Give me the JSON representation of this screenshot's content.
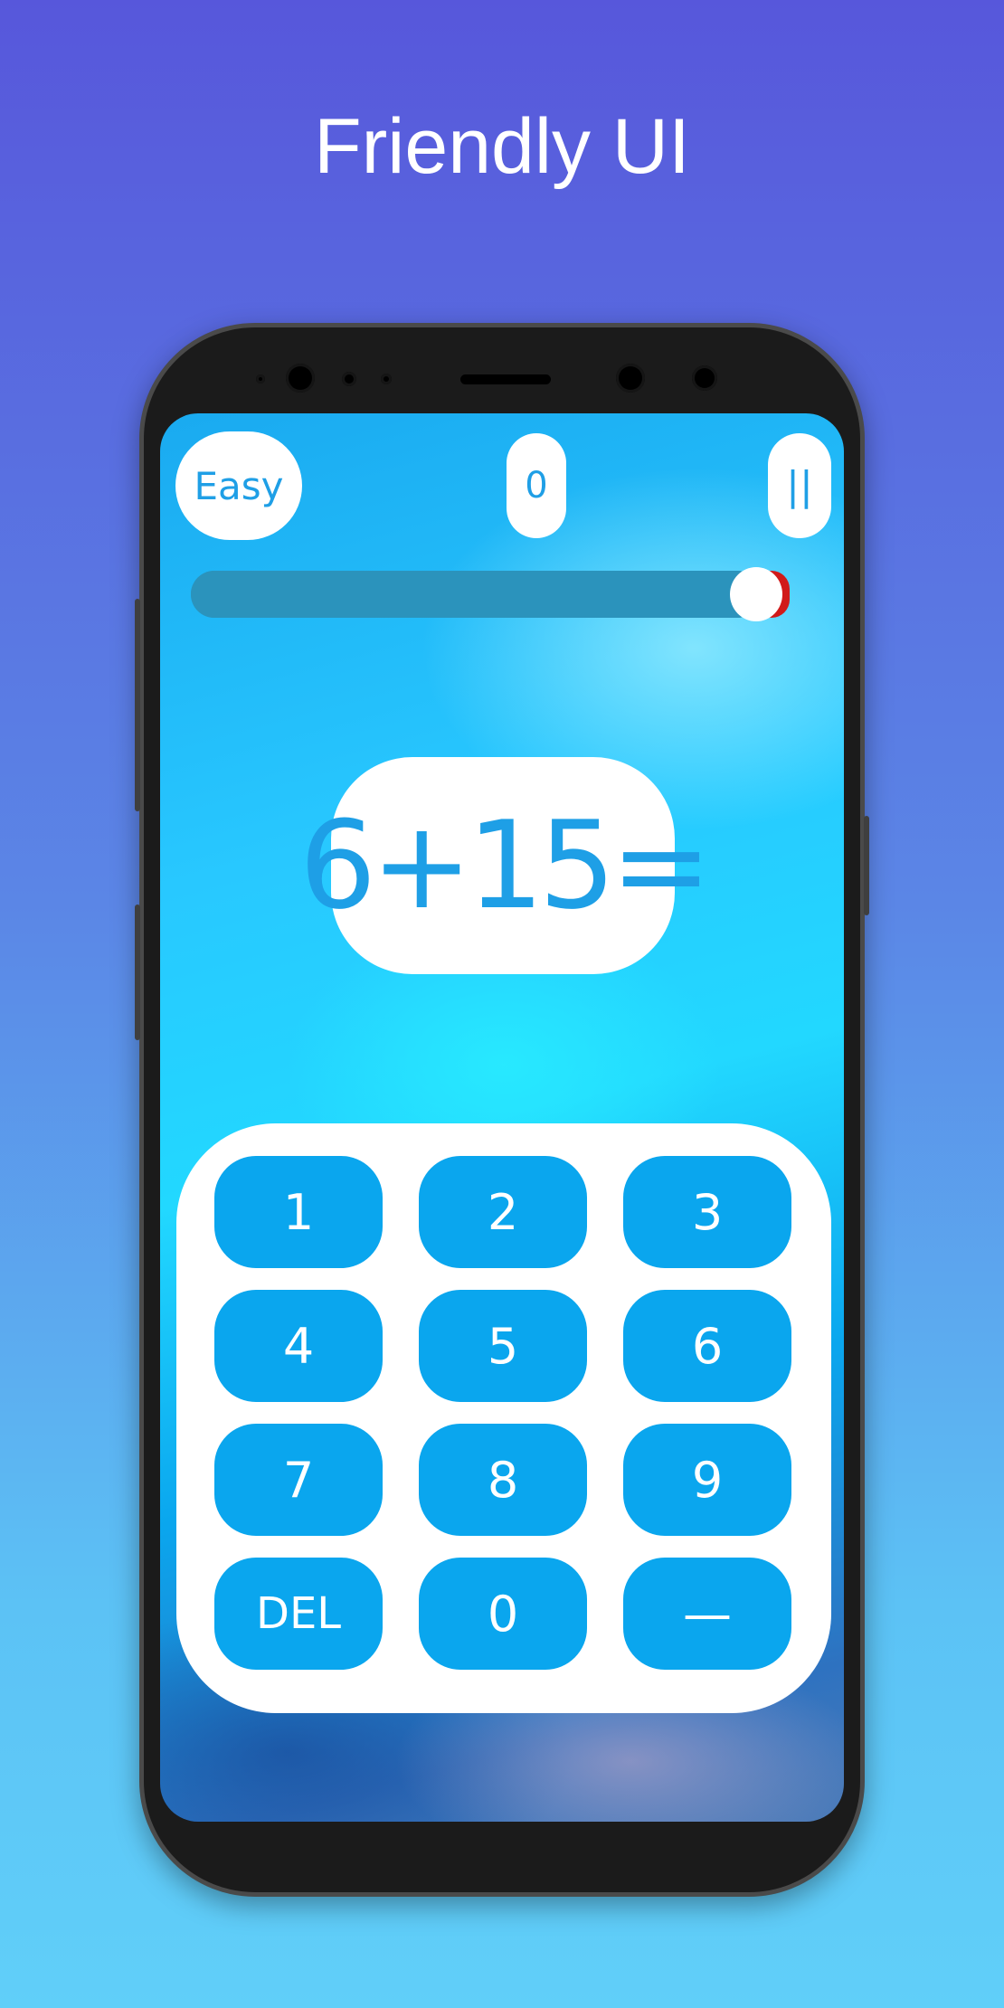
{
  "headline": "Friendly UI",
  "game": {
    "difficulty_label": "Easy",
    "score": "0",
    "pause_label": "||",
    "timer_remaining_fraction": 1.0,
    "question": "6+15="
  },
  "keypad": {
    "keys": [
      {
        "label": "1",
        "name": "key-1"
      },
      {
        "label": "2",
        "name": "key-2"
      },
      {
        "label": "3",
        "name": "key-3"
      },
      {
        "label": "4",
        "name": "key-4"
      },
      {
        "label": "5",
        "name": "key-5"
      },
      {
        "label": "6",
        "name": "key-6"
      },
      {
        "label": "7",
        "name": "key-7"
      },
      {
        "label": "8",
        "name": "key-8"
      },
      {
        "label": "9",
        "name": "key-9"
      },
      {
        "label": "DEL",
        "name": "key-delete"
      },
      {
        "label": "0",
        "name": "key-0"
      },
      {
        "label": "—",
        "name": "key-minus"
      }
    ]
  },
  "colors": {
    "accent_blue": "#0aa6ee",
    "text_blue": "#1e9fe6",
    "timer_track": "#2b93bc",
    "timer_end_red": "#d11a1a"
  }
}
